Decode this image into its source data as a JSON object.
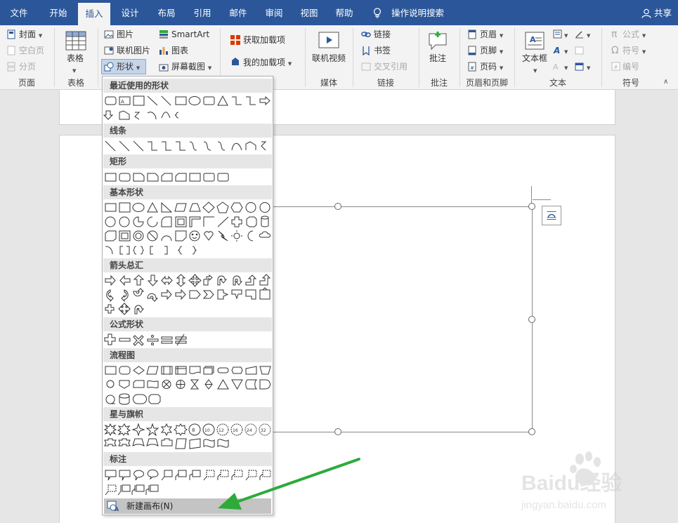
{
  "tabs": [
    "文件",
    "开始",
    "插入",
    "设计",
    "布局",
    "引用",
    "邮件",
    "审阅",
    "视图",
    "帮助"
  ],
  "active_tab": "插入",
  "tell_me": "操作说明搜索",
  "share": "共享",
  "ribbon": {
    "pages": {
      "cover": "封面",
      "blank": "空白页",
      "break": "分页",
      "label": "页面"
    },
    "tables": {
      "table": "表格",
      "label": "表格"
    },
    "illustrations": {
      "pictures": "图片",
      "online_pictures": "联机图片",
      "shapes": "形状",
      "smartart": "SmartArt",
      "chart": "图表",
      "screenshot": "屏幕截图"
    },
    "addins": {
      "get": "获取加载项",
      "mine": "我的加载项"
    },
    "media": {
      "online_video": "联机视频",
      "label": "媒体"
    },
    "links": {
      "link": "链接",
      "bookmark": "书签",
      "crossref": "交叉引用",
      "label": "链接"
    },
    "comments": {
      "comment": "批注",
      "label": "批注"
    },
    "header_footer": {
      "header": "页眉",
      "footer": "页脚",
      "page_number": "页码",
      "label": "页眉和页脚"
    },
    "text": {
      "textbox": "文本框",
      "label": "文本"
    },
    "symbols": {
      "equation": "公式",
      "symbol": "符号",
      "number": "编号",
      "label": "符号"
    }
  },
  "shapes_menu": {
    "categories": [
      "最近使用的形状",
      "线条",
      "矩形",
      "基本形状",
      "箭头总汇",
      "公式形状",
      "流程图",
      "星与旗帜",
      "标注"
    ],
    "new_canvas": "新建画布(N)"
  },
  "watermark": {
    "brand": "Baidu经验",
    "url": "jingyan.baidu.com"
  },
  "colors": {
    "accent": "#2b579a",
    "annotation": "#2eaa3a"
  }
}
